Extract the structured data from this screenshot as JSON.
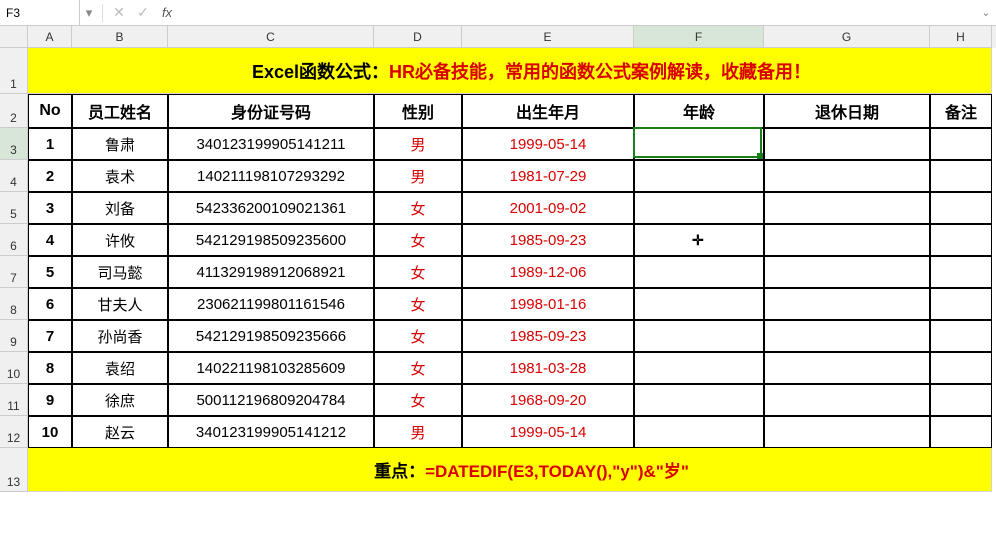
{
  "nameBox": "F3",
  "formula": "",
  "columns": [
    "A",
    "B",
    "C",
    "D",
    "E",
    "F",
    "G",
    "H"
  ],
  "selectedCol": "F",
  "selectedRow": 3,
  "rowLabels": [
    1,
    2,
    3,
    4,
    5,
    6,
    7,
    8,
    9,
    10,
    11,
    12,
    13
  ],
  "bannerBlack": "Excel函数公式：",
  "bannerRed": "HR必备技能，常用的函数公式案例解读，收藏备用！",
  "headers": {
    "no": "No",
    "name": "员工姓名",
    "id": "身份证号码",
    "gender": "性别",
    "birth": "出生年月",
    "age": "年龄",
    "retire": "退休日期",
    "note": "备注"
  },
  "rows": [
    {
      "no": "1",
      "name": "鲁肃",
      "id": "340123199905141211",
      "gender": "男",
      "birth": "1999-05-14"
    },
    {
      "no": "2",
      "name": "袁术",
      "id": "140211198107293292",
      "gender": "男",
      "birth": "1981-07-29"
    },
    {
      "no": "3",
      "name": "刘备",
      "id": "542336200109021361",
      "gender": "女",
      "birth": "2001-09-02"
    },
    {
      "no": "4",
      "name": "许攸",
      "id": "542129198509235600",
      "gender": "女",
      "birth": "1985-09-23"
    },
    {
      "no": "5",
      "name": "司马懿",
      "id": "411329198912068921",
      "gender": "女",
      "birth": "1989-12-06"
    },
    {
      "no": "6",
      "name": "甘夫人",
      "id": "230621199801161546",
      "gender": "女",
      "birth": "1998-01-16"
    },
    {
      "no": "7",
      "name": "孙尚香",
      "id": "542129198509235666",
      "gender": "女",
      "birth": "1985-09-23"
    },
    {
      "no": "8",
      "name": "袁绍",
      "id": "140221198103285609",
      "gender": "女",
      "birth": "1981-03-28"
    },
    {
      "no": "9",
      "name": "徐庶",
      "id": "500112196809204784",
      "gender": "女",
      "birth": "1968-09-20"
    },
    {
      "no": "10",
      "name": "赵云",
      "id": "340123199905141212",
      "gender": "男",
      "birth": "1999-05-14"
    }
  ],
  "footerBlack": "重点：",
  "footerRed": "=DATEDIF(E3,TODAY(),\"y\")&\"岁\"",
  "heights": {
    "banner": 46,
    "header": 34,
    "data": 32,
    "footer": 44
  }
}
